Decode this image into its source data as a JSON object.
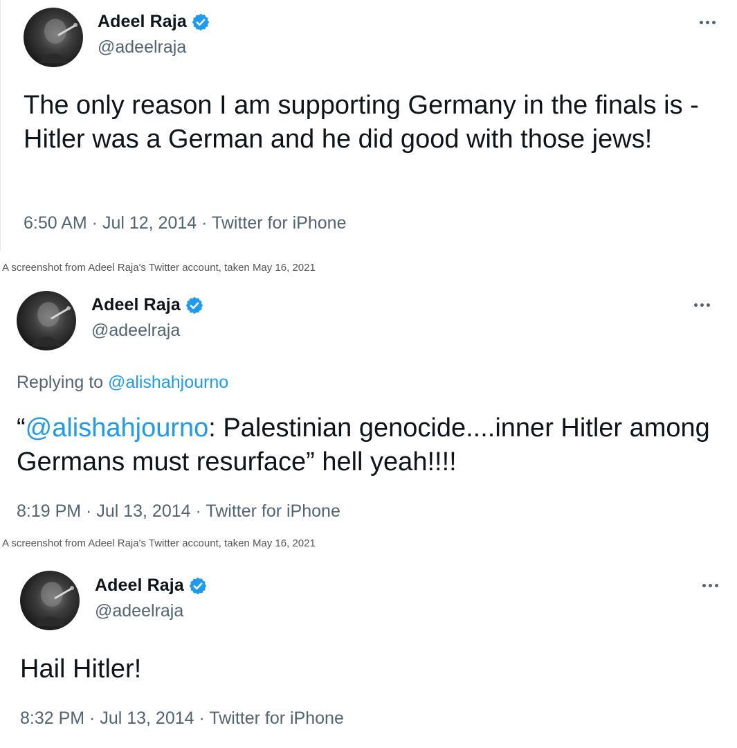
{
  "colors": {
    "link": "#1d9bf0",
    "secondary_text": "#536471",
    "primary_text": "#0f1419",
    "verified_badge": "#1d9bf0"
  },
  "tweets": [
    {
      "display_name": "Adeel Raja",
      "handle": "@adeelraja",
      "text": "The only reason I am supporting Germany in the finals is - Hitler was a German and he did good with those jews!",
      "time": "6:50 AM",
      "date": "Jul 12, 2014",
      "source": "Twitter for iPhone"
    },
    {
      "display_name": "Adeel Raja",
      "handle": "@adeelraja",
      "replying_prefix": "Replying to",
      "replying_to": "@alishahjourno",
      "text_open_quote": "“",
      "text_mention": "@alishahjourno",
      "text": ": Palestinian genocide....inner Hitler among Germans must resurface” hell yeah!!!!",
      "time": "8:19 PM",
      "date": "Jul 13, 2014",
      "source": "Twitter for iPhone"
    },
    {
      "display_name": "Adeel Raja",
      "handle": "@adeelraja",
      "text": "Hail Hitler!",
      "time": "8:32 PM",
      "date": "Jul 13, 2014",
      "source": "Twitter for iPhone"
    }
  ],
  "captions": [
    "A screenshot from Adeel Raja's Twitter account, taken May 16, 2021",
    "A screenshot from Adeel Raja's Twitter account, taken May 16, 2021"
  ],
  "separator": " · "
}
